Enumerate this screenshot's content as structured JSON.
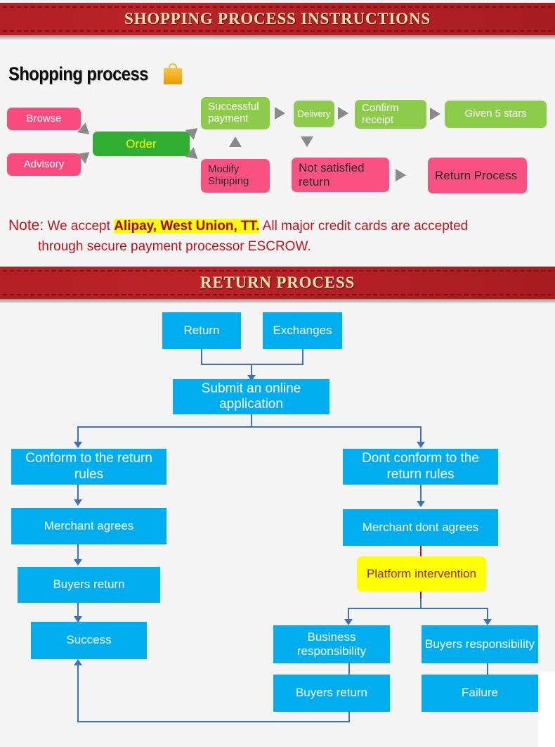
{
  "banners": {
    "shopping": "SHOPPING PROCESS INSTRUCTIONS",
    "return": "RETURN PROCESS"
  },
  "section": {
    "shopping_heading": "Shopping process",
    "bag_icon": "shopping-bag-icon"
  },
  "shopping_flow": {
    "boxes": [
      {
        "id": "browse",
        "label": "Browse"
      },
      {
        "id": "advisory",
        "label": "Advisory"
      },
      {
        "id": "order",
        "label": "Order"
      },
      {
        "id": "successful-payment",
        "label": "Successful payment"
      },
      {
        "id": "delivery",
        "label": "Delivery"
      },
      {
        "id": "confirm-receipt",
        "label": "Confirm receipt"
      },
      {
        "id": "given-5-stars",
        "label": "Given 5 stars"
      },
      {
        "id": "modify-shipping",
        "label": "Modify Shipping"
      },
      {
        "id": "not-satisfied",
        "label": "Not satisfied return"
      },
      {
        "id": "return-process",
        "label": "Return Process"
      }
    ],
    "colors": {
      "pink": "#f94b80",
      "green": "#2fae32",
      "light_green": "#8ccc4a",
      "order_text": "#ffff00",
      "arrow": "#8a8a8a"
    }
  },
  "note": {
    "label": "Note:",
    "text_before": "We accept ",
    "highlight": "Alipay, West Union, TT.",
    "text_after": " All major credit cards are accepted",
    "line2": "through secure payment processor ESCROW.",
    "highlight_color": "#ffff00",
    "text_color": "#c1121c"
  },
  "return_flow": {
    "boxes": [
      {
        "id": "return",
        "label": "Return"
      },
      {
        "id": "exchanges",
        "label": "Exchanges"
      },
      {
        "id": "submit-online-app",
        "label": "Submit an online application"
      },
      {
        "id": "conform-return-rules",
        "label": "Conform to the return rules"
      },
      {
        "id": "dont-conform-rules",
        "label": "Dont conform to the return rules"
      },
      {
        "id": "merchant-agrees",
        "label": "Merchant agrees"
      },
      {
        "id": "merchant-dont-agrees",
        "label": "Merchant dont agrees"
      },
      {
        "id": "buyers-return-left",
        "label": "Buyers return"
      },
      {
        "id": "platform-intervention",
        "label": "Platform intervention"
      },
      {
        "id": "success",
        "label": "Success"
      },
      {
        "id": "business-responsibility",
        "label": "Business responsibility"
      },
      {
        "id": "buyers-responsibility",
        "label": "Buyers responsibility"
      },
      {
        "id": "buyers-return-mid",
        "label": "Buyers return"
      },
      {
        "id": "failure",
        "label": "Failure"
      }
    ],
    "colors": {
      "box": "#00aeef",
      "highlight_box": "#ffff00",
      "highlight_text": "#a32020",
      "connector": "#3d72b8",
      "connector_red": "#9d1f28"
    }
  }
}
